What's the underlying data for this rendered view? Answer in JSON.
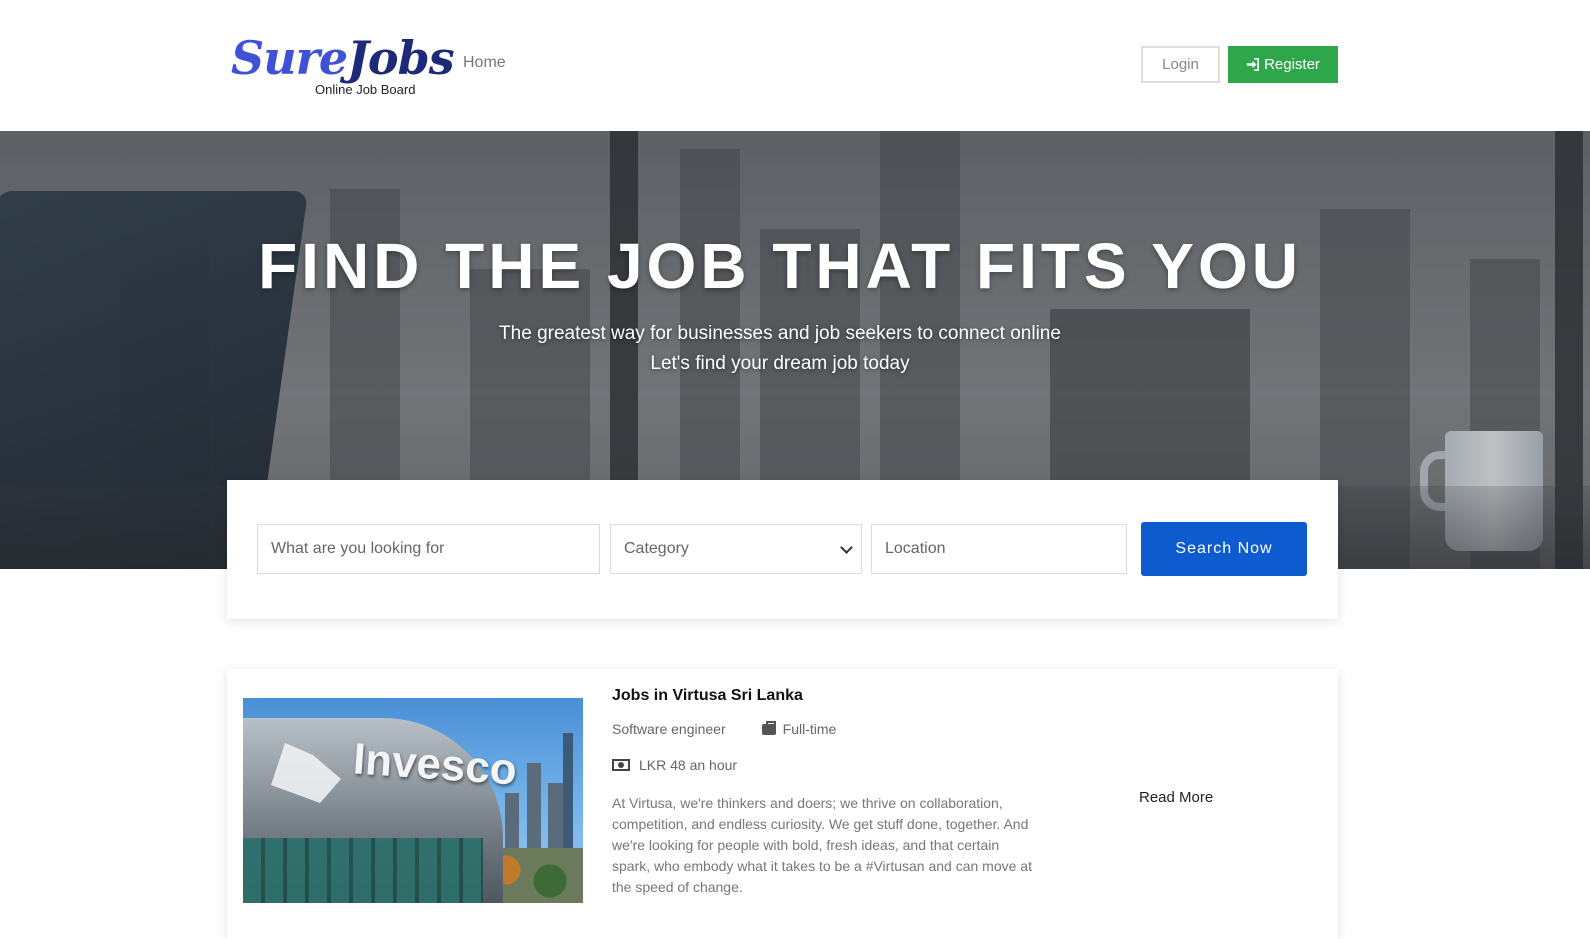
{
  "brand": {
    "name_part1": "Sure",
    "name_part2": "Jobs",
    "tagline": "Online Job Board"
  },
  "nav": {
    "home": "Home",
    "login": "Login",
    "register": "Register"
  },
  "hero": {
    "title": "FIND THE JOB THAT FITS YOU",
    "subtitle_line1": "The greatest way for businesses and job seekers to connect online",
    "subtitle_line2": "Let's find your dream job today"
  },
  "search": {
    "keyword_placeholder": "What are you looking for",
    "keyword_value": "",
    "category_selected": "Category",
    "location_placeholder": "Location",
    "location_value": "",
    "button": "Search Now"
  },
  "jobs": [
    {
      "title": "Jobs in Virtusa Sri Lanka",
      "position": "Software engineer",
      "type": "Full-time",
      "salary": "LKR 48 an hour",
      "description": "At Virtusa, we're thinkers and doers; we thrive on collaboration, competition, and endless curiosity. We get stuff done, together. And we're looking for people with bold, fresh ideas, and that certain spark, who embody what it takes to be a #Virtusan and can move at the speed of change.",
      "image_brand": "Invesco",
      "read_more": "Read More"
    }
  ],
  "colors": {
    "register": "#2ea64a",
    "search_button": "#0e5bd0",
    "logo_primary": "#3f51d6",
    "logo_dark": "#1e2a78"
  },
  "icons": {
    "register": "sign-in-icon",
    "job_type": "briefcase-icon",
    "salary": "money-icon",
    "category": "chevron-down-icon"
  }
}
